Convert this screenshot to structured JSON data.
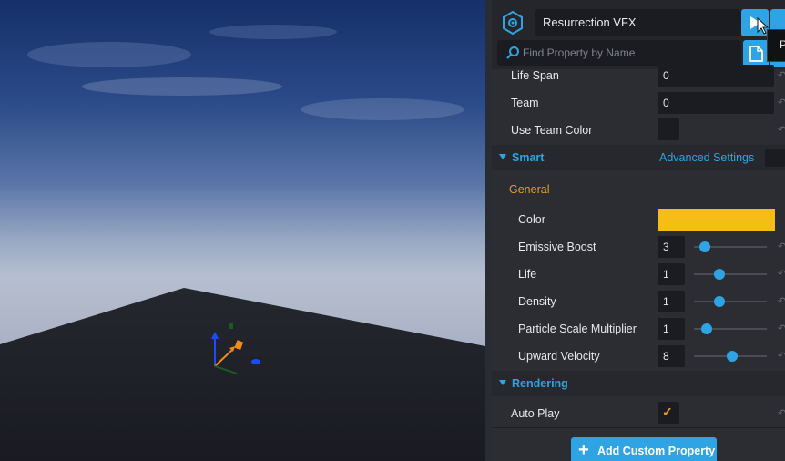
{
  "header": {
    "object_name": "Resurrection VFX",
    "search_placeholder": "Find Property by Name",
    "tooltip_fragment": "P"
  },
  "properties_top": [
    {
      "label": "Life Span",
      "value": "0"
    },
    {
      "label": "Team",
      "value": "0"
    },
    {
      "label": "Use Team Color",
      "value": ""
    }
  ],
  "smart_section": {
    "title": "Smart",
    "advanced_label": "Advanced Settings",
    "group_label": "General",
    "color_label": "Color",
    "color_value": "#f5be14",
    "sliders": [
      {
        "label": "Emissive Boost",
        "value": "3",
        "level": 0.15
      },
      {
        "label": "Life",
        "value": "1",
        "level": 0.35
      },
      {
        "label": "Density",
        "value": "1",
        "level": 0.35
      },
      {
        "label": "Particle Scale Multiplier",
        "value": "1",
        "level": 0.18
      },
      {
        "label": "Upward Velocity",
        "value": "8",
        "level": 0.52
      }
    ]
  },
  "rendering_section": {
    "title": "Rendering",
    "auto_play_label": "Auto Play",
    "auto_play_checked": true
  },
  "add_button_label": "Add Custom Property",
  "colors": {
    "accent": "#2ea4e4",
    "group_label": "#e89a2c",
    "panel_bg": "#2b2d33"
  }
}
